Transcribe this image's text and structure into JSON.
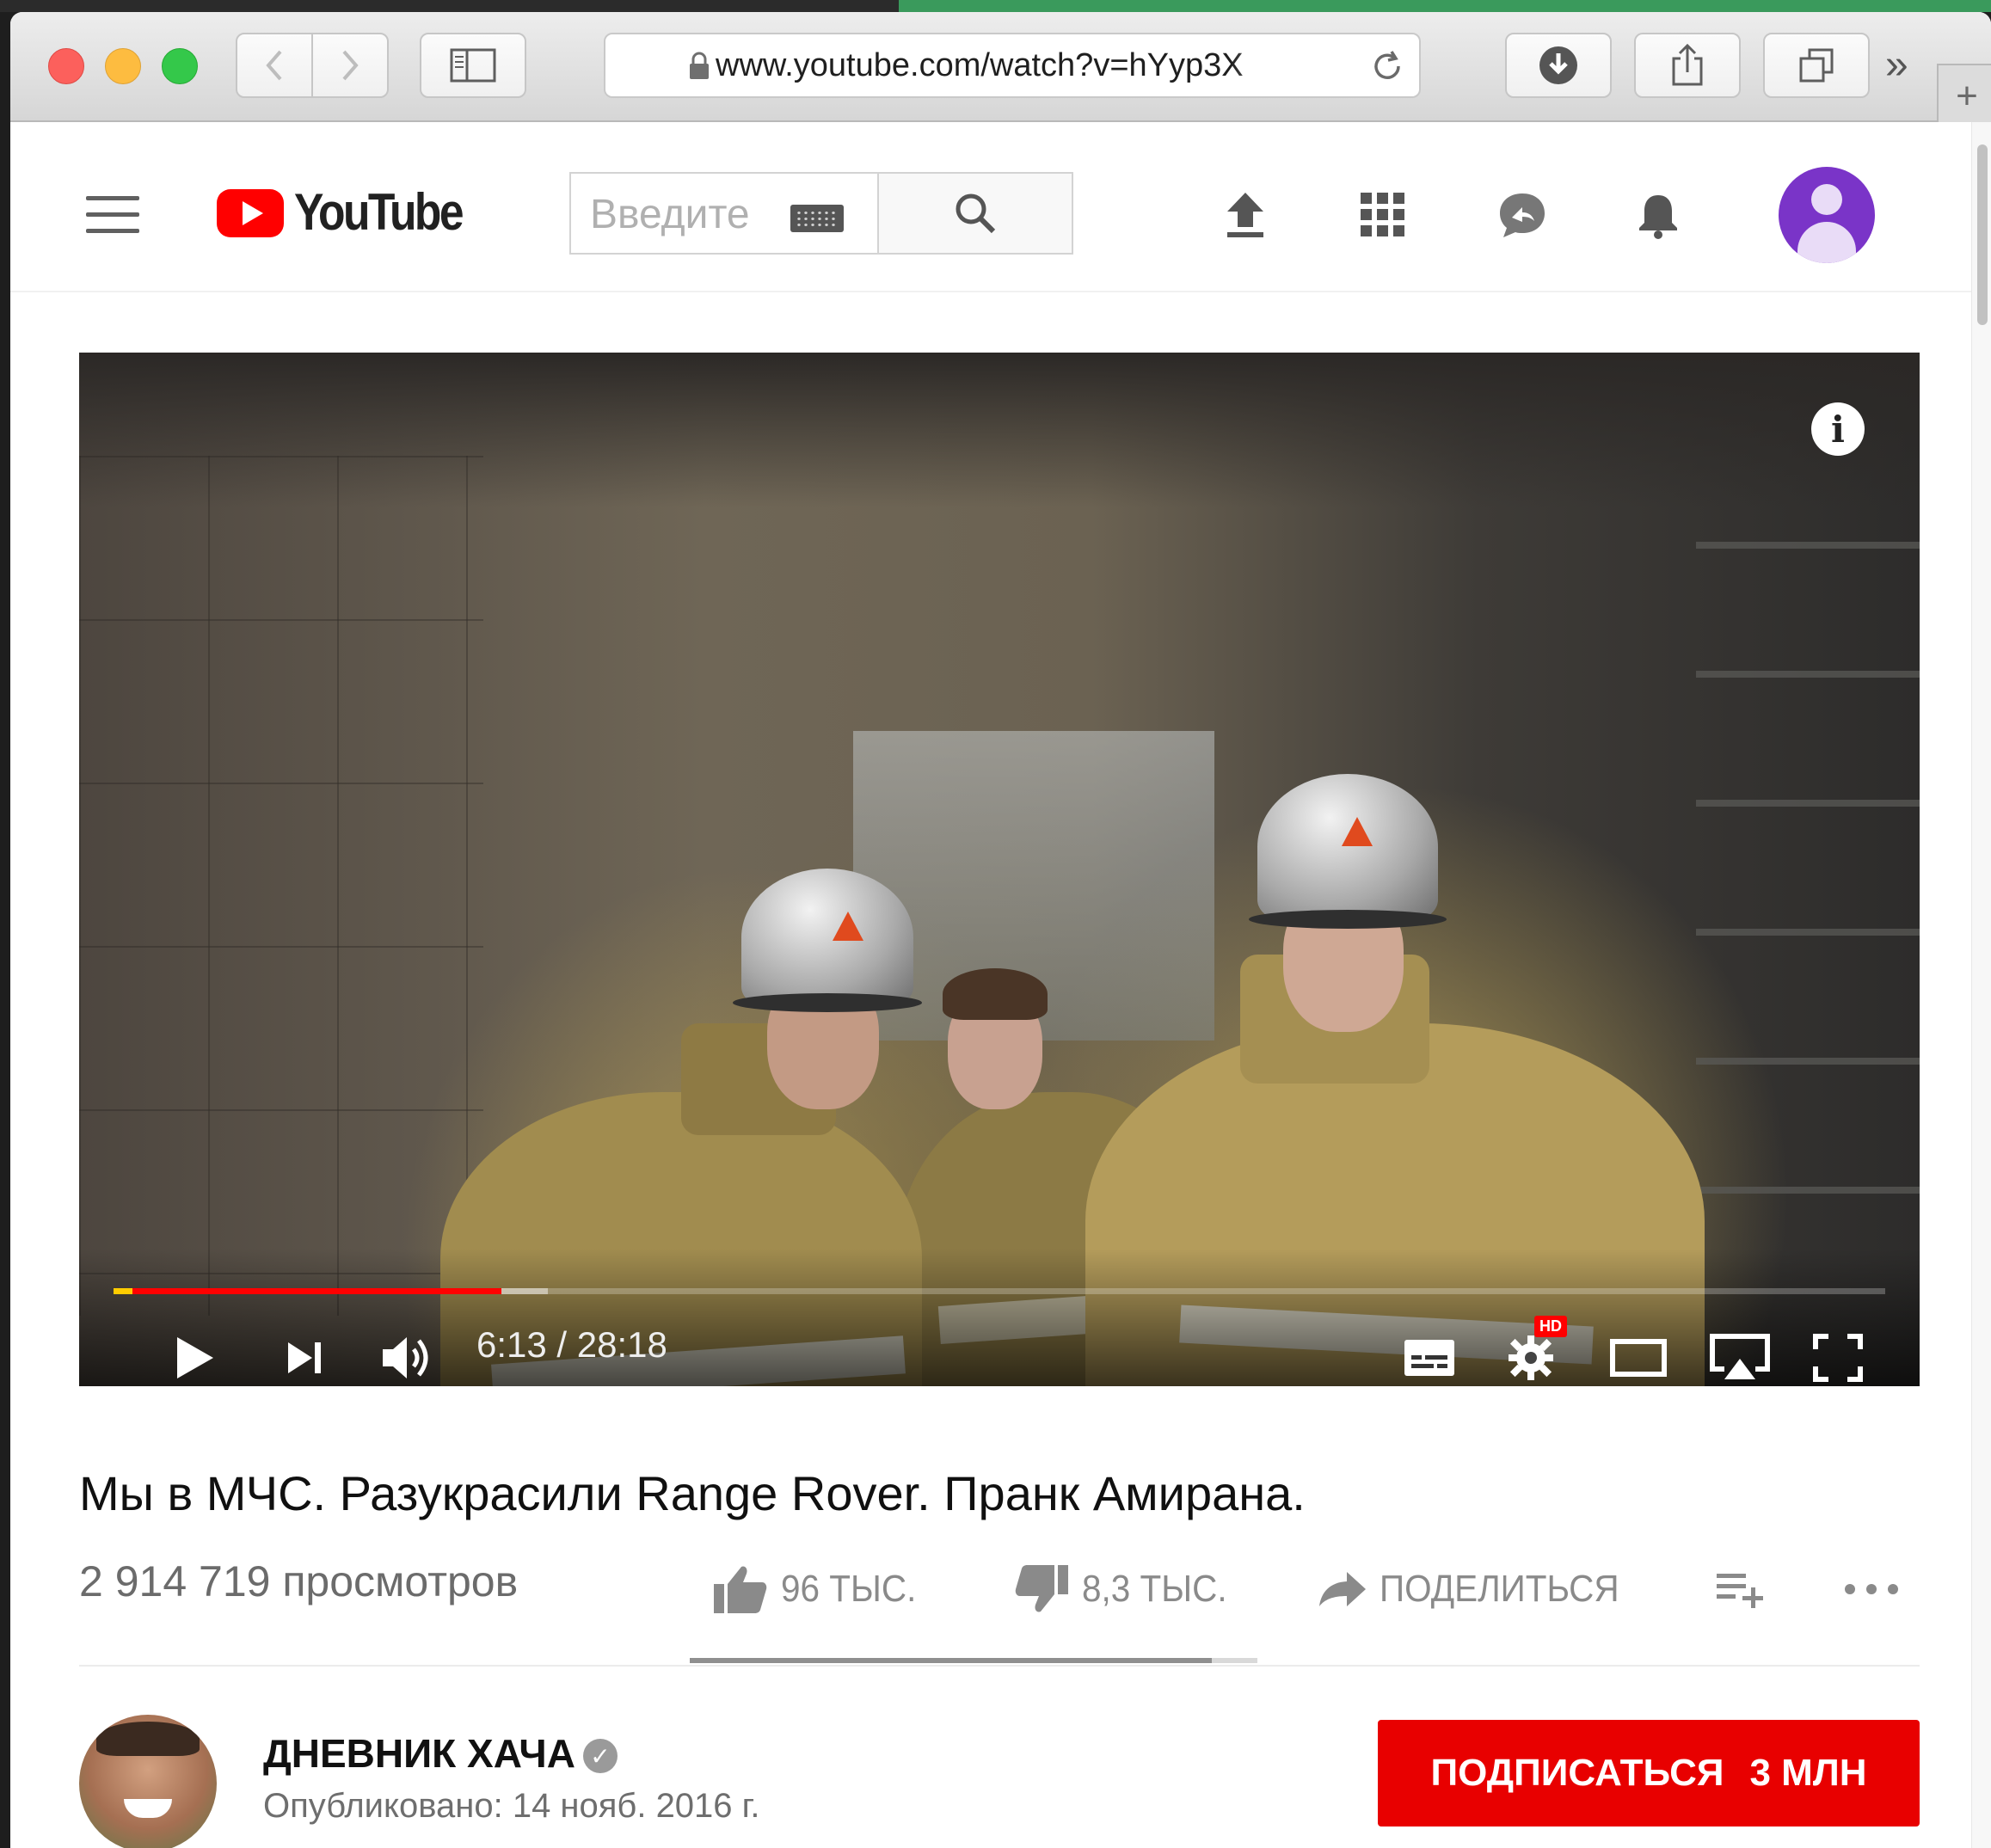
{
  "browser": {
    "url": "www.youtube.com/watch?v=hYyp3X",
    "buttons": {
      "back_icon": "chevron-left-icon",
      "forward_icon": "chevron-right-icon",
      "sidebar_icon": "sidebar-icon",
      "reload_icon": "reload-icon",
      "downloads_icon": "download-icon",
      "share_icon": "share-icon",
      "tabs_icon": "tabs-icon",
      "more_icon": "double-chevron-right-icon",
      "new_tab_icon": "plus-icon"
    },
    "more_label": "»",
    "new_tab_label": "+"
  },
  "youtube": {
    "logo_text": "YouTube",
    "search_placeholder": "Введите",
    "header_icons": [
      "upload-icon",
      "apps-icon",
      "messages-icon",
      "notifications-icon",
      "account-avatar"
    ]
  },
  "player": {
    "time": "6:13 / 28:18",
    "played_fraction": 0.219,
    "buffered_fraction": 0.245,
    "hd_badge": "HD",
    "info_label": "i"
  },
  "video": {
    "title": "Мы в МЧС. Разукрасили Range Rover. Пранк Амирана.",
    "views": "2 914 719 просмотров",
    "likes": "96 ТЫС.",
    "dislikes": "8,3 ТЫС.",
    "share_label": "ПОДЕЛИТЬСЯ",
    "like_ratio": 0.92
  },
  "channel": {
    "name": "ДНЕВНИК ХАЧА",
    "published": "Опубликовано: 14 нояб. 2016 г.",
    "subscribe_label": "ПОДПИСАТЬСЯ",
    "subscribers": "3 МЛН"
  },
  "colors": {
    "youtube_red": "#ff0000",
    "subscribe_red": "#e80000",
    "avatar_purple": "#7a34c8"
  }
}
